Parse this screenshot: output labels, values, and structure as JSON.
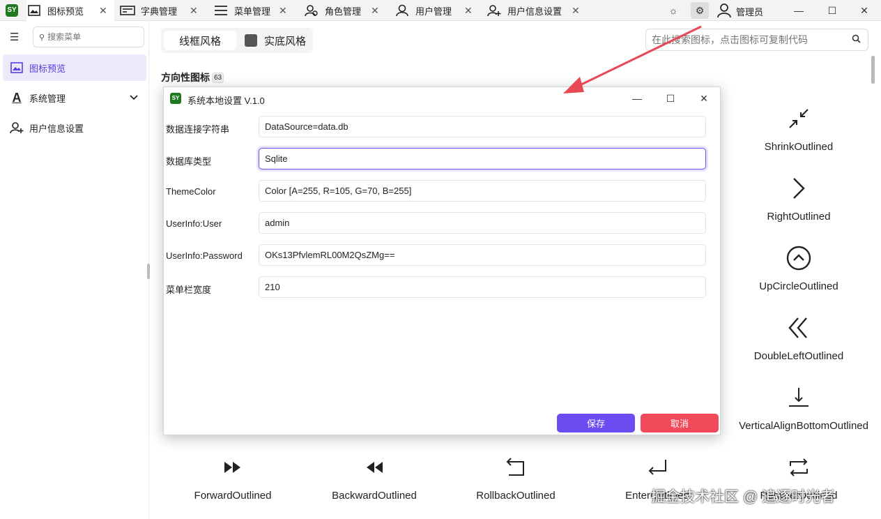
{
  "app": {
    "logo_text": "SY"
  },
  "tabs": [
    {
      "label": "图标预览",
      "icon": "image-icon",
      "active": true
    },
    {
      "label": "字典管理",
      "icon": "dictionary-icon"
    },
    {
      "label": "菜单管理",
      "icon": "menu-icon"
    },
    {
      "label": "角色管理",
      "icon": "role-icon"
    },
    {
      "label": "用户管理",
      "icon": "user-icon"
    },
    {
      "label": "用户信息设置",
      "icon": "user-settings-icon"
    }
  ],
  "titlebar": {
    "user_label": "管理员"
  },
  "sidebar": {
    "search_placeholder": "搜索菜单",
    "items": [
      {
        "label": "图标预览",
        "icon": "image-icon",
        "active": true
      },
      {
        "label": "系统管理",
        "icon": "font-icon",
        "expandable": true
      },
      {
        "label": "用户信息设置",
        "icon": "user-settings-icon"
      }
    ]
  },
  "main": {
    "style_tabs": [
      {
        "label": "线框风格",
        "active": true
      },
      {
        "label": "实底风格"
      }
    ],
    "icon_search_placeholder": "在此搜索图标，点击图标可复制代码",
    "section_title": "方向性图标",
    "section_count": "63",
    "icons": [
      {
        "name": "ShrinkOutlined"
      },
      {
        "name": "RightOutlined"
      },
      {
        "name": "UpCircleOutlined"
      },
      {
        "name": "DoubleLeftOutlined"
      },
      {
        "name": "VerticalAlignBottomOutlined"
      },
      {
        "name": "ForwardOutlined"
      },
      {
        "name": "BackwardOutlined"
      },
      {
        "name": "RollbackOutlined"
      },
      {
        "name": "EnterOutlined"
      },
      {
        "name": "RetweetOutlined"
      }
    ]
  },
  "dialog": {
    "title": "系统本地设置 V.1.0",
    "fields": [
      {
        "label": "数据连接字符串",
        "value": "DataSource=data.db"
      },
      {
        "label": "数据库类型",
        "value": "Sqlite",
        "focused": true
      },
      {
        "label": "ThemeColor",
        "value": "Color [A=255, R=105, G=70, B=255]"
      },
      {
        "label": "UserInfo:User",
        "value": "admin"
      },
      {
        "label": "UserInfo:Password",
        "value": "OKs13PfvlemRL00M2QsZMg=="
      },
      {
        "label": "菜单栏宽度",
        "value": "210"
      }
    ],
    "save_label": "保存",
    "cancel_label": "取消"
  },
  "watermark": "掘金技术社区 @ 追逐时光者",
  "colors": {
    "accent": "#6a4cf0",
    "danger": "#f04a5a",
    "logo": "#1f7a1f",
    "arrow": "#e84a55"
  }
}
